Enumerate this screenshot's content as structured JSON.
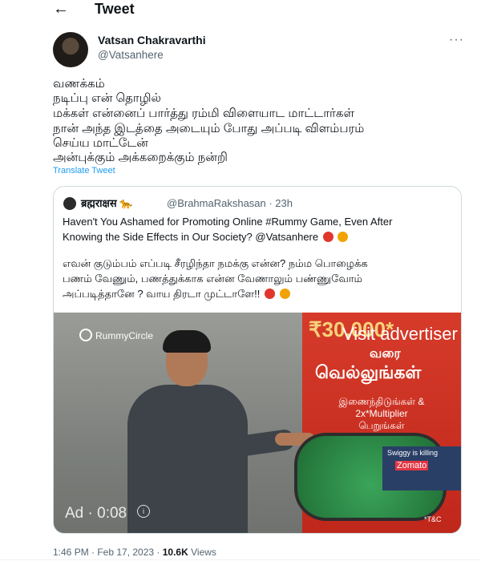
{
  "header": {
    "back_label": "←",
    "title": "Tweet"
  },
  "tweet": {
    "author_name": "Vatsan Chakravarthi",
    "author_handle": "@Vatsanhere",
    "more_label": "···",
    "lines": [
      "வணக்கம்",
      "நடிப்பு என் தொழில்",
      "மக்கள் என்னைப் பார்த்து ரம்மி விளையாட மாட்டார்கள்",
      "நான் அந்த இடத்தை அடையும் போது அப்படி விளம்பரம்",
      "செய்ய மாட்டேன்",
      "அன்புக்கும் அக்கறைக்கும் நன்றி"
    ],
    "translate_label": "Translate Tweet",
    "time": "1:46 PM · Feb 17, 2023 ·",
    "views_count": "10.6K",
    "views_label": "Views"
  },
  "quote": {
    "author_name": "ब्रह्मराक्षस 🐆",
    "author_handle_time": "@BrahmaRakshasan · 23h",
    "line1": "Haven't You Ashamed for Promoting Online #Rummy Game, Even After",
    "line2": "Knowing the Side Effects in Our Society? @Vatsanhere",
    "line3": "எவன் குடும்பம் எப்படி சீரழிந்தா நமக்கு என்ன? நம்ம பொழைக்க",
    "line4": "பணம் வேணும், பணத்துக்காக என்ன வேணாலும் பண்ணுவோம்",
    "line5": "அப்படித்தானே ? வாய திரடா முட்டாளே!!"
  },
  "media": {
    "brand": "RummyCircle",
    "amount": "₹30,000*",
    "advertiser": "Visit advertiser",
    "varai": "வரை",
    "vellungal": "வெல்லுங்கள்",
    "join_line1": "இணைந்திடுங்கள் &",
    "join_line2": "2x*Multiplier",
    "join_line3": "பெறுங்கள்",
    "swiggy": "Swiggy is killing",
    "zomato": "Zomato",
    "tc": "*T&C",
    "ad_label": "Ad · 0:08",
    "info_icon": "info-icon"
  },
  "colors": {
    "link": "#1d9bf0",
    "muted": "#536471",
    "ad_red": "#d63b2a",
    "border": "#cfd9de"
  }
}
